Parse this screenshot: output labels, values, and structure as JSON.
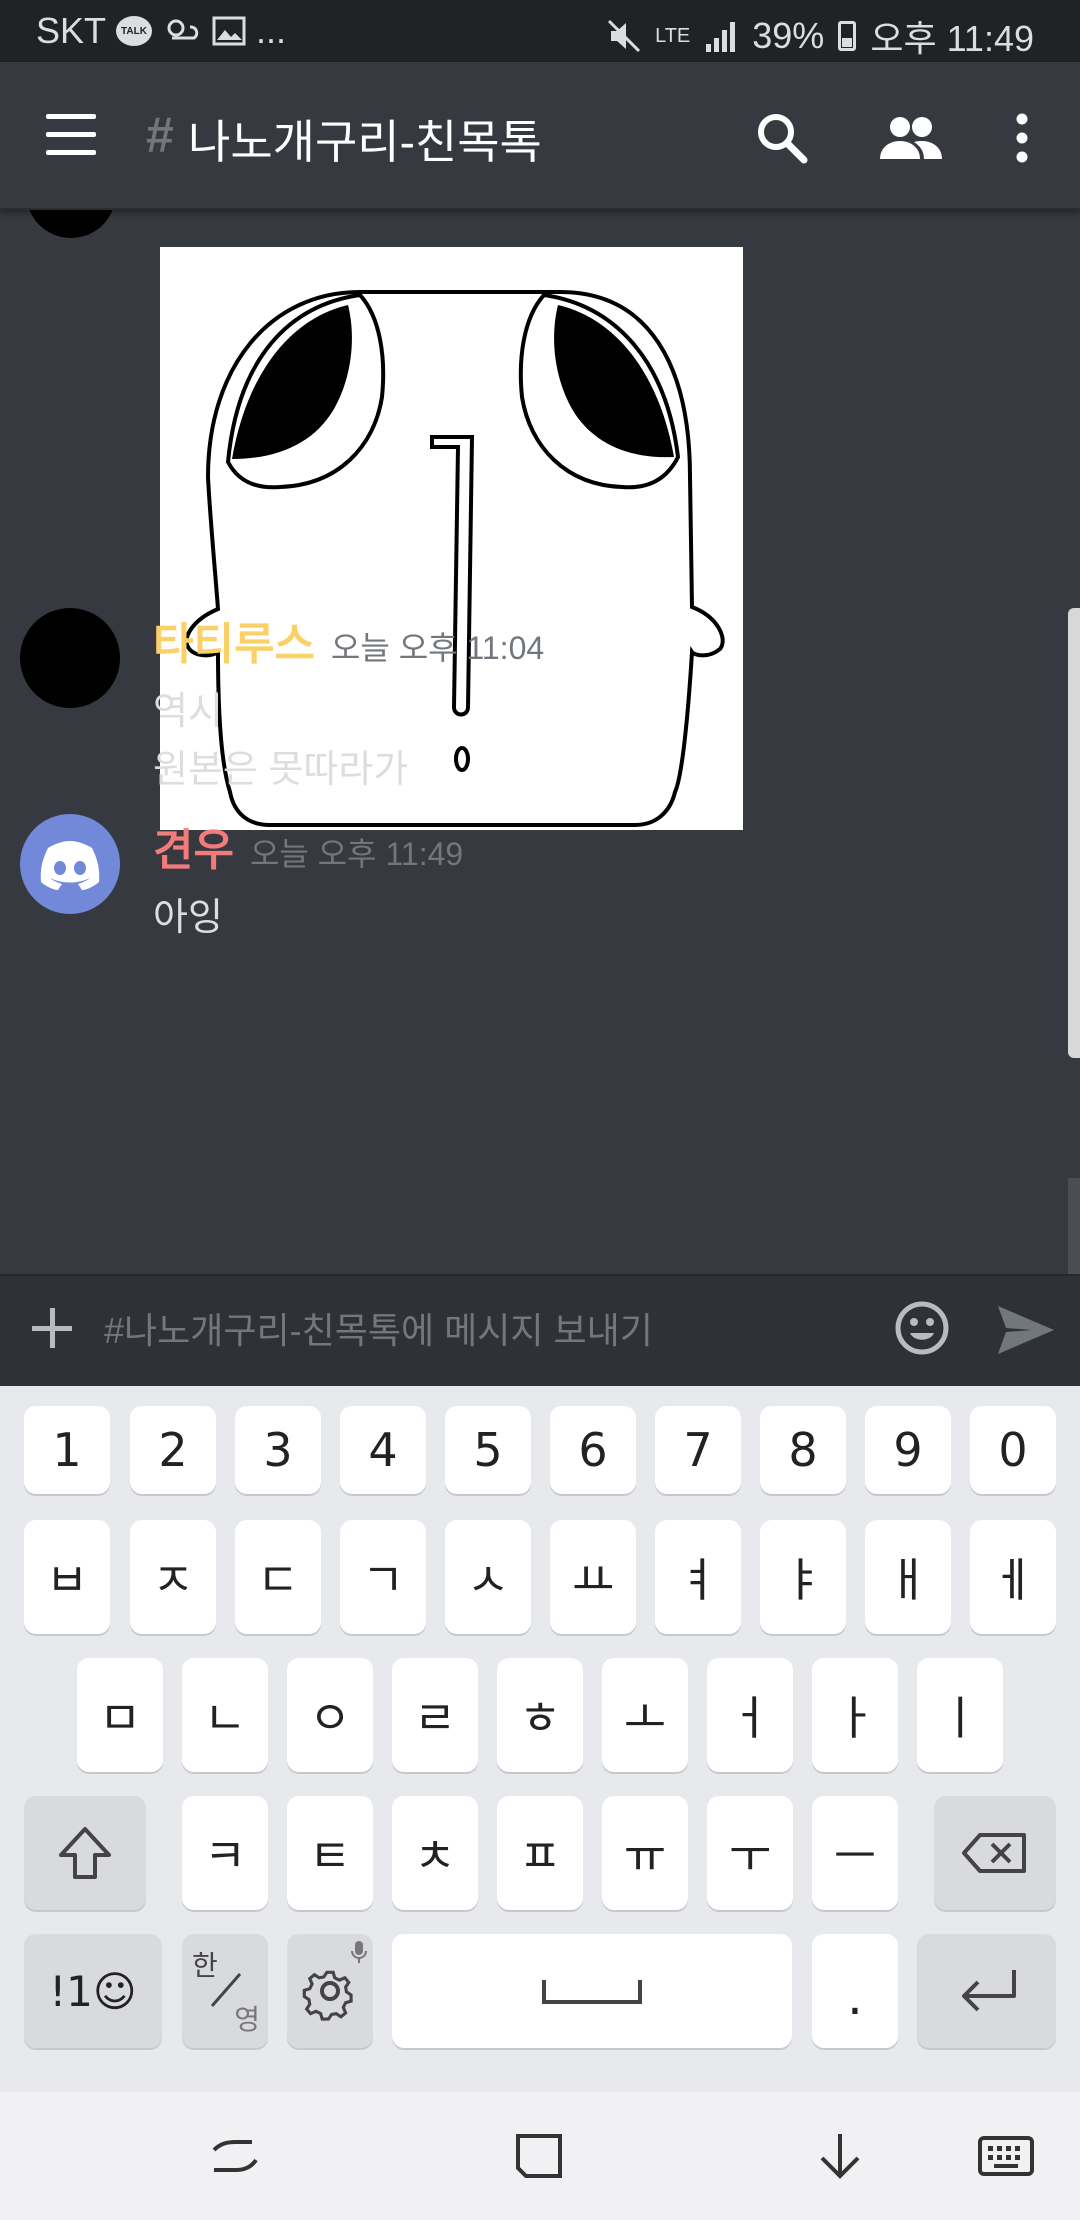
{
  "status_bar": {
    "carrier": "SKT",
    "talk_badge": "TALK",
    "more": "...",
    "network": "LTE",
    "battery": "39%",
    "time": "오후 11:49"
  },
  "header": {
    "hash": "#",
    "channel_name": "나노개구리-친목톡",
    "icons": [
      "menu-icon",
      "search-icon",
      "members-icon",
      "more-vert-icon"
    ]
  },
  "messages": [
    {
      "author": "타티루스",
      "author_color": "#fad166",
      "timestamp": "오늘 오후 11:04",
      "lines": [
        "역시",
        "원본은 못따라가"
      ]
    },
    {
      "author": "견우",
      "author_color": "#f47b7b",
      "timestamp": "오늘 오후 11:49",
      "lines": [
        "아잉"
      ]
    }
  ],
  "composer": {
    "placeholder": "#나노개구리-친목톡에 메시지 보내기"
  },
  "keyboard": {
    "numbers": [
      "1",
      "2",
      "3",
      "4",
      "5",
      "6",
      "7",
      "8",
      "9",
      "0"
    ],
    "row1": [
      "ㅂ",
      "ㅈ",
      "ㄷ",
      "ㄱ",
      "ㅅ",
      "ㅛ",
      "ㅕ",
      "ㅑ",
      "ㅐ",
      "ㅔ"
    ],
    "row2": [
      "ㅁ",
      "ㄴ",
      "ㅇ",
      "ㄹ",
      "ㅎ",
      "ㅗ",
      "ㅓ",
      "ㅏ",
      "ㅣ"
    ],
    "row3": [
      "ㅋ",
      "ㅌ",
      "ㅊ",
      "ㅍ",
      "ㅠ",
      "ㅜ",
      "ㅡ"
    ],
    "symbols_key": "!1☺",
    "lang_top": "한",
    "lang_bottom": "영",
    "period": "."
  }
}
